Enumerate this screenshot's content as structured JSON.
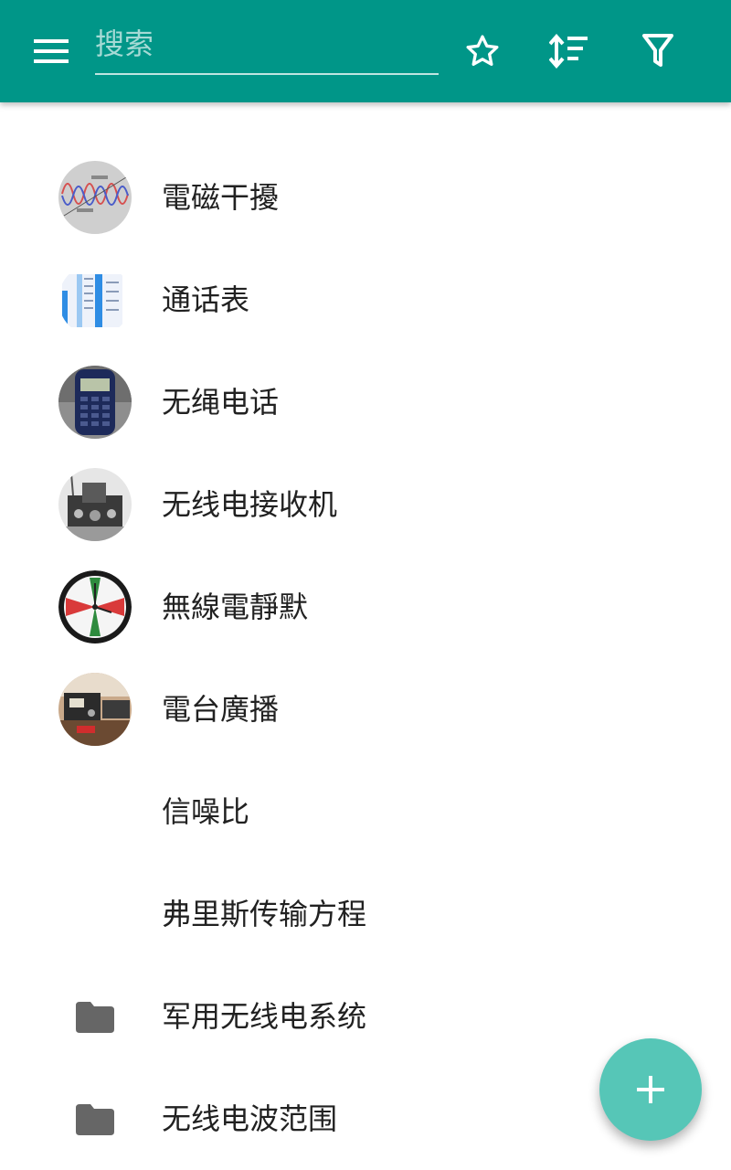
{
  "colors": {
    "toolbar": "#009688",
    "fab": "#56c6b7",
    "text": "#212121",
    "folder_icon": "#666666"
  },
  "toolbar": {
    "menu_icon": "hamburger-menu-icon",
    "search": {
      "placeholder": "搜索",
      "value": ""
    },
    "star_icon": "star-outline-icon",
    "sort_icon": "sort-icon",
    "filter_icon": "filter-icon"
  },
  "items": [
    {
      "label": "電磁干擾",
      "icon": "emi-diagram-thumbnail"
    },
    {
      "label": "通话表",
      "icon": "call-table-thumbnail"
    },
    {
      "label": "无绳电话",
      "icon": "cordless-phone-thumbnail"
    },
    {
      "label": "无线电接收机",
      "icon": "radio-receiver-thumbnail"
    },
    {
      "label": "無線電靜默",
      "icon": "clock-thumbnail"
    },
    {
      "label": "電台廣播",
      "icon": "radio-station-thumbnail"
    },
    {
      "label": "信噪比",
      "icon": ""
    },
    {
      "label": "弗里斯传输方程",
      "icon": ""
    },
    {
      "label": "军用无线电系统",
      "icon": "folder-icon"
    },
    {
      "label": "无线电波范围",
      "icon": "folder-icon"
    }
  ],
  "fab": {
    "icon": "plus-icon"
  }
}
